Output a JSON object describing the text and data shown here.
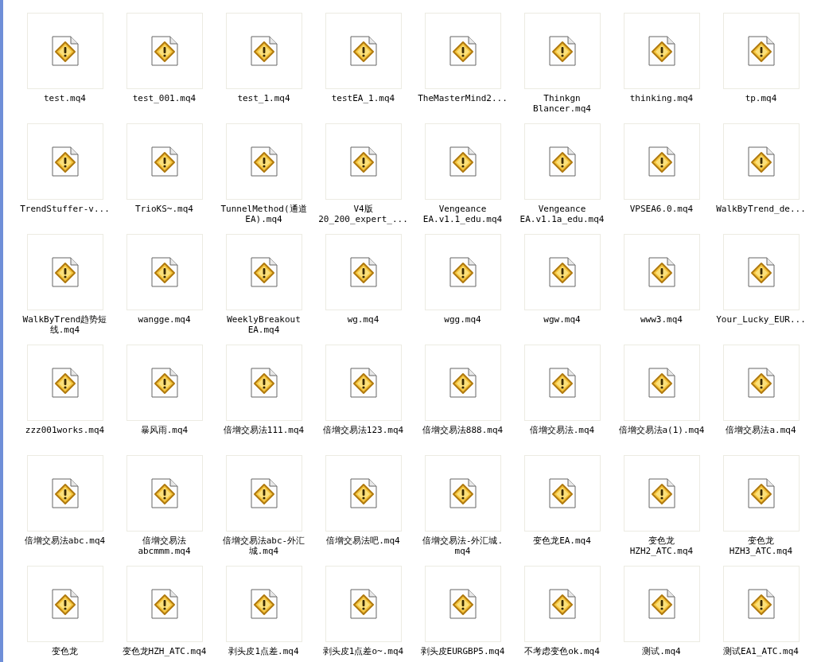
{
  "files": [
    {
      "lines": [
        "test.mq4"
      ]
    },
    {
      "lines": [
        "test_001.mq4"
      ]
    },
    {
      "lines": [
        "test_1.mq4"
      ]
    },
    {
      "lines": [
        "testEA_1.mq4"
      ]
    },
    {
      "lines": [
        "TheMasterMind2..."
      ]
    },
    {
      "lines": [
        "Thinkgn",
        "Blancer.mq4"
      ]
    },
    {
      "lines": [
        "thinking.mq4"
      ]
    },
    {
      "lines": [
        "tp.mq4"
      ]
    },
    {
      "lines": [
        "TrendStuffer-v..."
      ]
    },
    {
      "lines": [
        "TrioKS~.mq4"
      ]
    },
    {
      "lines": [
        "TunnelMethod(通道",
        "EA).mq4"
      ]
    },
    {
      "lines": [
        "V4版",
        "20_200_expert_..."
      ]
    },
    {
      "lines": [
        "Vengeance",
        "EA.v1.1_edu.mq4"
      ]
    },
    {
      "lines": [
        "Vengeance",
        "EA.v1.1a_edu.mq4"
      ]
    },
    {
      "lines": [
        "VPSEA6.0.mq4"
      ]
    },
    {
      "lines": [
        "WalkByTrend_de..."
      ]
    },
    {
      "lines": [
        "WalkByTrend趋势短",
        "线.mq4"
      ]
    },
    {
      "lines": [
        "wangge.mq4"
      ]
    },
    {
      "lines": [
        "WeeklyBreakout",
        "EA.mq4"
      ]
    },
    {
      "lines": [
        "wg.mq4"
      ]
    },
    {
      "lines": [
        "wgg.mq4"
      ]
    },
    {
      "lines": [
        "wgw.mq4"
      ]
    },
    {
      "lines": [
        "www3.mq4"
      ]
    },
    {
      "lines": [
        "Your_Lucky_EUR..."
      ]
    },
    {
      "lines": [
        "zzz001works.mq4"
      ]
    },
    {
      "lines": [
        "暴风雨.mq4"
      ]
    },
    {
      "lines": [
        "倍增交易法111.mq4"
      ]
    },
    {
      "lines": [
        "倍增交易法123.mq4"
      ]
    },
    {
      "lines": [
        "倍增交易法888.mq4"
      ]
    },
    {
      "lines": [
        "倍增交易法.mq4"
      ]
    },
    {
      "lines": [
        "倍增交易法a(1).mq4"
      ]
    },
    {
      "lines": [
        "倍增交易法a.mq4"
      ]
    },
    {
      "lines": [
        "倍增交易法abc.mq4"
      ]
    },
    {
      "lines": [
        "倍增交易法",
        "abcmmm.mq4"
      ]
    },
    {
      "lines": [
        "倍增交易法abc-外汇",
        "城.mq4"
      ]
    },
    {
      "lines": [
        "倍增交易法吧.mq4"
      ]
    },
    {
      "lines": [
        "倍增交易法-外汇城.",
        "mq4"
      ]
    },
    {
      "lines": [
        "变色龙EA.mq4"
      ]
    },
    {
      "lines": [
        "变色龙",
        "HZH2_ATC.mq4"
      ]
    },
    {
      "lines": [
        "变色龙",
        "HZH3_ATC.mq4"
      ]
    },
    {
      "lines": [
        "变色龙"
      ]
    },
    {
      "lines": [
        "变色龙HZH_ATC.mq4"
      ]
    },
    {
      "lines": [
        "剥头皮1点差.mq4"
      ]
    },
    {
      "lines": [
        "剥头皮1点差o~.mq4"
      ]
    },
    {
      "lines": [
        "剥头皮EURGBP5.mq4"
      ]
    },
    {
      "lines": [
        "不考虑变色ok.mq4"
      ]
    },
    {
      "lines": [
        "测试.mq4"
      ]
    },
    {
      "lines": [
        "测试EA1_ATC.mq4"
      ]
    }
  ]
}
